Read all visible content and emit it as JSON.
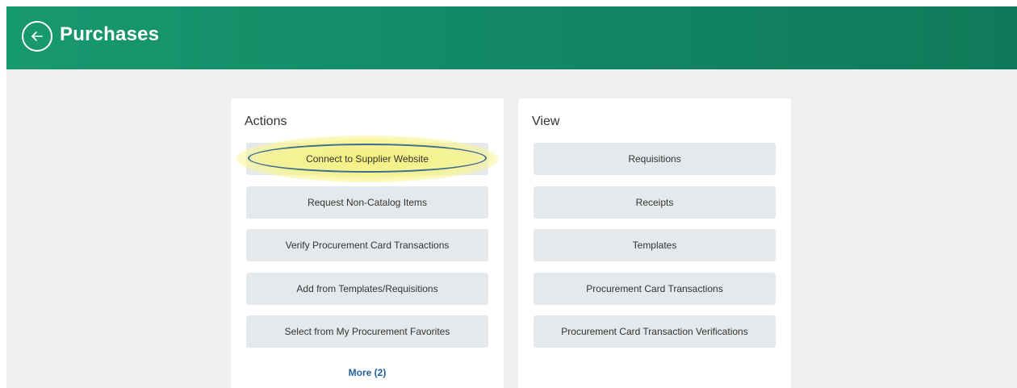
{
  "header": {
    "title": "Purchases",
    "back_icon": "arrow-left-icon",
    "colors": {
      "start": "#17996f",
      "end": "#0f7a59"
    }
  },
  "actions": {
    "title": "Actions",
    "buttons": [
      {
        "label": "Connect to Supplier Website",
        "highlighted": true
      },
      {
        "label": "Request Non-Catalog Items"
      },
      {
        "label": "Verify Procurement Card Transactions"
      },
      {
        "label": "Add from Templates/Requisitions"
      },
      {
        "label": "Select from My Procurement Favorites"
      }
    ],
    "more_label": "More (2)"
  },
  "view": {
    "title": "View",
    "buttons": [
      {
        "label": "Requisitions"
      },
      {
        "label": "Receipts"
      },
      {
        "label": "Templates"
      },
      {
        "label": "Procurement Card Transactions"
      },
      {
        "label": "Procurement Card Transaction Verifications"
      }
    ]
  }
}
